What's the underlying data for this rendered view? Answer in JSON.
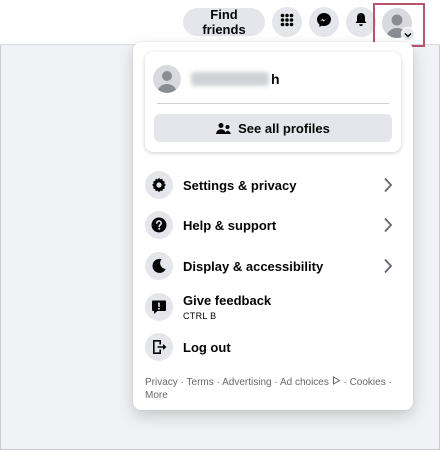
{
  "header": {
    "find_friends_label": "Find friends"
  },
  "dropdown": {
    "profile": {
      "name_visible": "h",
      "see_all_label": "See all profiles"
    },
    "menu": [
      {
        "label": "Settings & privacy",
        "icon": "gear-icon",
        "has_chevron": true
      },
      {
        "label": "Help & support",
        "icon": "question-icon",
        "has_chevron": true
      },
      {
        "label": "Display & accessibility",
        "icon": "moon-icon",
        "has_chevron": true
      },
      {
        "label": "Give feedback",
        "sublabel": "CTRL B",
        "icon": "feedback-icon",
        "has_chevron": false
      },
      {
        "label": "Log out",
        "icon": "logout-icon",
        "has_chevron": false
      }
    ],
    "footer": {
      "privacy": "Privacy",
      "terms": "Terms",
      "advertising": "Advertising",
      "ad_choices": "Ad choices",
      "cookies": "Cookies",
      "more": "More",
      "separator": "·"
    }
  },
  "colors": {
    "highlight_border": "#b5566b",
    "button_gray": "#e4e6eb",
    "page_bg": "#f0f2f5"
  }
}
